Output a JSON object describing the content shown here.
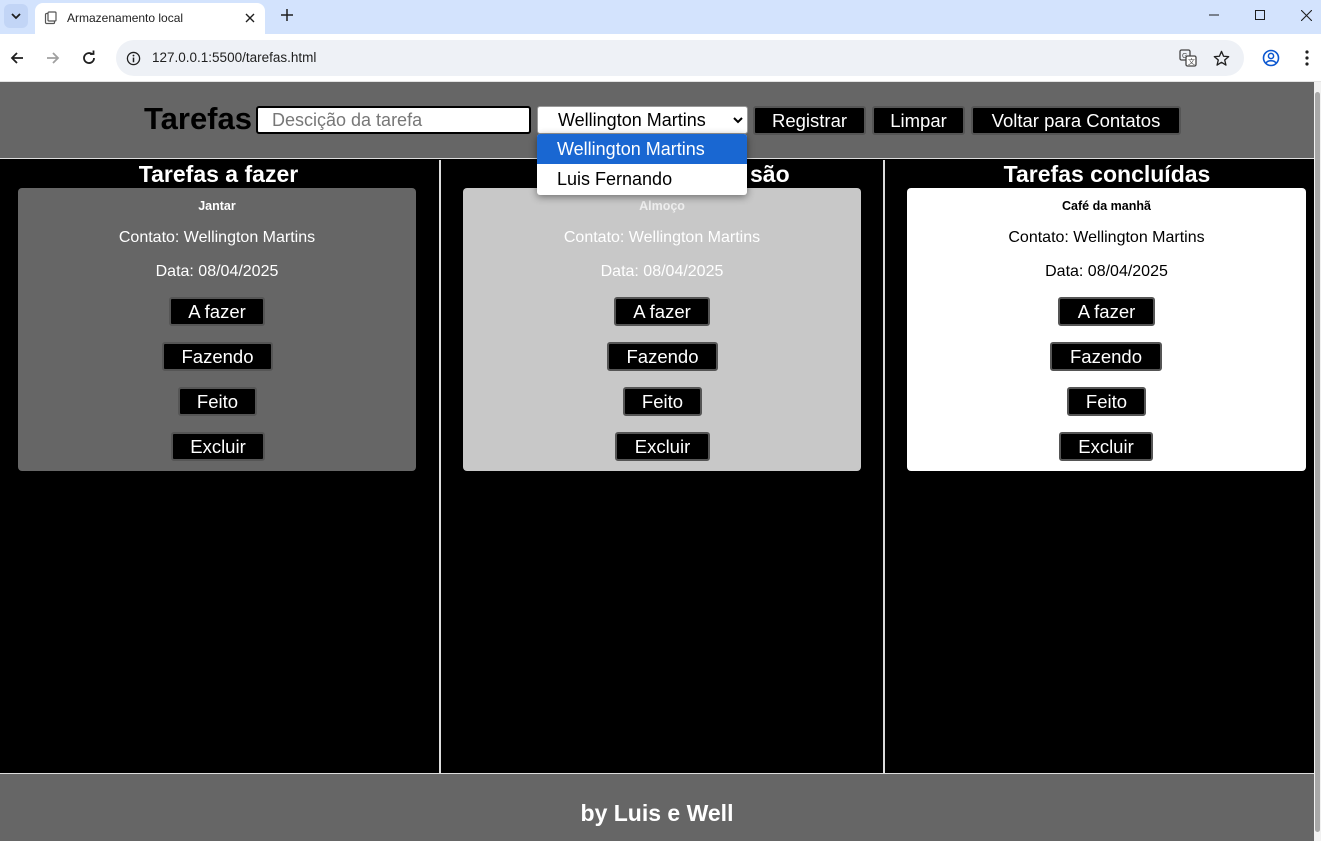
{
  "browser": {
    "tab_title": "Armazenamento local",
    "url": "127.0.0.1:5500/tarefas.html"
  },
  "header": {
    "title": "Tarefas",
    "description_placeholder": "Descição da tarefa",
    "selected_contact": "Wellington Martins",
    "register_label": "Registrar",
    "clear_label": "Limpar",
    "back_label": "Voltar para Contatos"
  },
  "dropdown": {
    "options": [
      "Wellington Martins",
      "Luis Fernando"
    ]
  },
  "columns": [
    {
      "title": "Tarefas a fazer"
    },
    {
      "title": "são"
    },
    {
      "title": "Tarefas concluídas"
    }
  ],
  "cards": [
    {
      "name": "Jantar",
      "contact": "Contato: Wellington Martins",
      "date": "Data: 08/04/2025",
      "bg": "#666666",
      "name_color": "#ffffff",
      "text_color": "#ffffff"
    },
    {
      "name": "Almoço",
      "contact": "Contato: Wellington Martins",
      "date": "Data: 08/04/2025",
      "bg": "#c8c8c8",
      "name_color": "#eeeeee",
      "text_color": "#ffffff"
    },
    {
      "name": "Café da manhã",
      "contact": "Contato: Wellington Martins",
      "date": "Data: 08/04/2025",
      "bg": "#ffffff",
      "name_color": "#000000",
      "text_color": "#000000"
    }
  ],
  "card_buttons": {
    "todo": "A fazer",
    "doing": "Fazendo",
    "done": "Feito",
    "delete": "Excluir"
  },
  "footer": {
    "text": "by Luis e Well"
  },
  "colors": {
    "header_bg": "#666666",
    "page_bg": "#000000",
    "dropdown_selected": "#1967d2",
    "browser_frame": "#d3e3fd"
  }
}
